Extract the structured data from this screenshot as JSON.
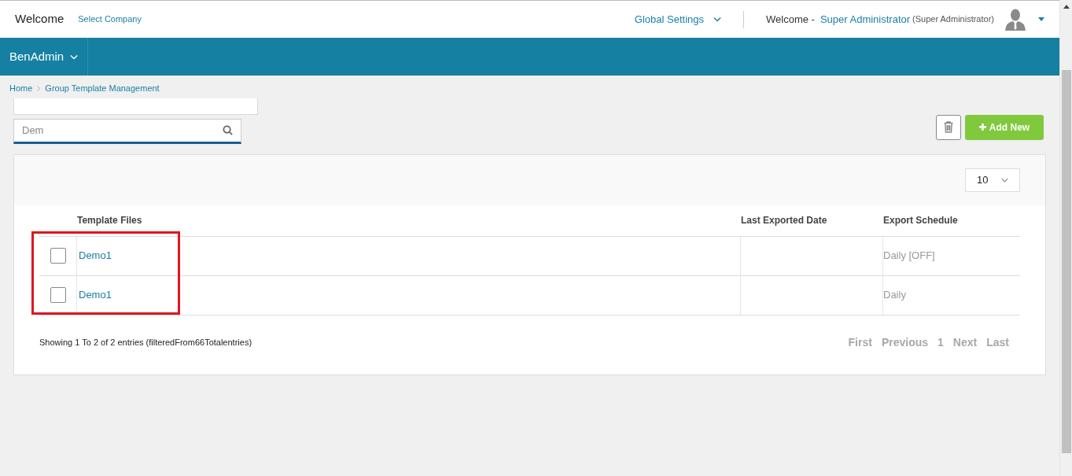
{
  "header": {
    "title": "Welcome",
    "company_link": "Select Company",
    "global_settings": "Global Settings",
    "welcome_prefix": "Welcome -",
    "user_name": "Super Administrator",
    "user_role": "(Super Administrator)"
  },
  "navbar": {
    "menu": "BenAdmin"
  },
  "breadcrumb": [
    "Home",
    "Group Template Management"
  ],
  "search": {
    "value": "Dem"
  },
  "toolbar": {
    "add_button": "Add New"
  },
  "page_size": "10",
  "table": {
    "columns": [
      "Template Files",
      "Last Exported Date",
      "Export Schedule"
    ],
    "rows": [
      {
        "checked": false,
        "name": "Demo1",
        "last_exported": "",
        "schedule": "Daily [OFF]"
      },
      {
        "checked": false,
        "name": "Demo1",
        "last_exported": "",
        "schedule": "Daily"
      }
    ]
  },
  "highlight": true,
  "footer": {
    "info": "Showing 1 To 2 of 2 entries (filteredFrom66Totalentries)",
    "pagination": [
      {
        "label": "First",
        "disabled": true
      },
      {
        "label": "Previous",
        "disabled": true
      },
      {
        "label": "1",
        "disabled": true
      },
      {
        "label": "Next",
        "disabled": true
      },
      {
        "label": "Last",
        "disabled": true
      }
    ]
  }
}
